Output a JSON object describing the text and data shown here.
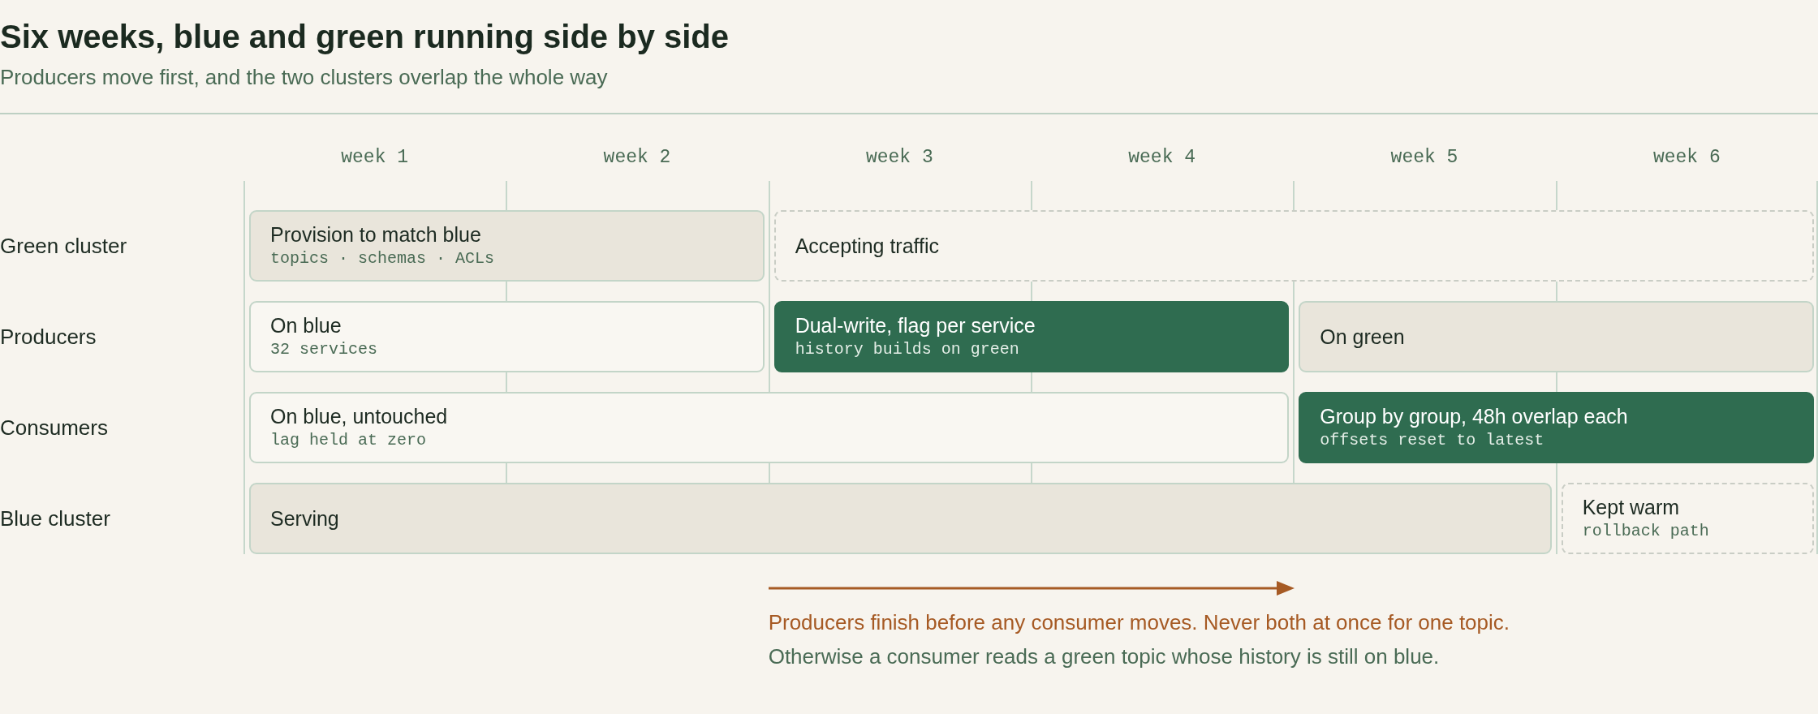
{
  "title": "Six weeks, blue and green running side by side",
  "subtitle": "Producers move first, and the two clusters overlap the whole way",
  "weeks": [
    "week 1",
    "week 2",
    "week 3",
    "week 4",
    "week 5",
    "week 6"
  ],
  "lanes": [
    {
      "label": "Green cluster",
      "bars": [
        {
          "kind": "fill",
          "title": "Provision to match blue",
          "detail": "topics · schemas · ACLs"
        },
        {
          "kind": "dashed",
          "title": "Accepting traffic"
        }
      ]
    },
    {
      "label": "Producers",
      "bars": [
        {
          "kind": "outline",
          "title": "On blue",
          "detail": "32 services"
        },
        {
          "kind": "solid",
          "title": "Dual-write, flag per service",
          "detail": "history builds on green"
        },
        {
          "kind": "fill",
          "title": "On green"
        }
      ]
    },
    {
      "label": "Consumers",
      "bars": [
        {
          "kind": "outline",
          "title": "On blue, untouched",
          "detail": "lag held at zero"
        },
        {
          "kind": "solid",
          "title": "Group by group, 48h overlap each",
          "detail": "offsets reset to latest"
        }
      ]
    },
    {
      "label": "Blue cluster",
      "bars": [
        {
          "kind": "fill",
          "title": "Serving"
        },
        {
          "kind": "dashed",
          "title": "Kept warm",
          "detail": "rollback path"
        }
      ]
    }
  ],
  "note": {
    "headline": "Producers finish before any consumer moves. Never both at once for one topic.",
    "detail": "Otherwise a consumer reads a green topic whose history is still on blue."
  }
}
